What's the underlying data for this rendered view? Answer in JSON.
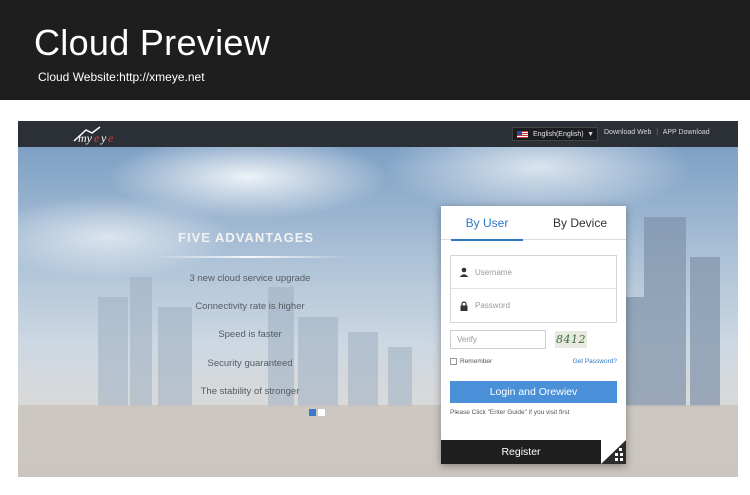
{
  "banner": {
    "title": "Cloud Preview",
    "subtitle": "Cloud Website:http://xmeye.net"
  },
  "nav": {
    "language": "English(English)",
    "download_web": "Download Web",
    "separator": "|",
    "app_download": "APP Download"
  },
  "hero": {
    "advantages_title": "FIVE ADVANTAGES",
    "advantages": [
      "3 new cloud service upgrade",
      "Connectivity rate is higher",
      "Speed is faster",
      "Security guaranteed",
      "The stability of stronger"
    ]
  },
  "login": {
    "tab_user": "By User",
    "tab_device": "By Device",
    "username_placeholder": "Username",
    "password_placeholder": "Password",
    "verify_placeholder": "Verify",
    "captcha": "8412",
    "remember": "Remember",
    "forgot": "Get Password?",
    "login_button": "Login and Orewiev",
    "guide": "Please Click \"Enter Guide\" if you visit first",
    "register_button": "Register"
  },
  "colors": {
    "accent": "#2f78c5",
    "button": "#4a90d9",
    "banner_bg": "#1e1e1e",
    "nav_bg": "#2b2f36"
  }
}
